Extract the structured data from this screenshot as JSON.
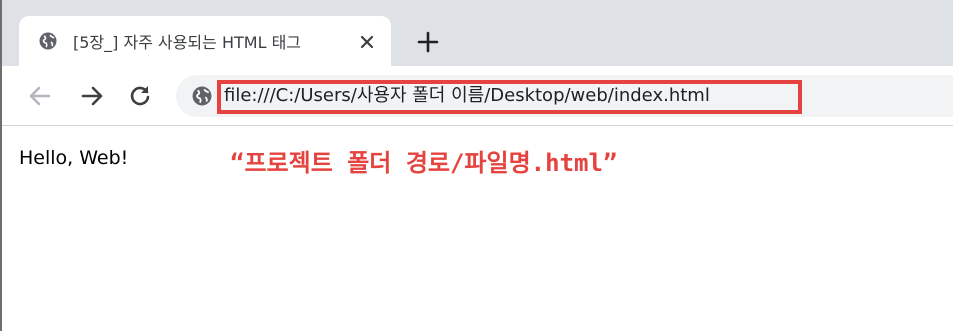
{
  "tab": {
    "title": "[5장_] 자주 사용되는 HTML 태그",
    "favicon": "globe-icon",
    "close": "close-icon"
  },
  "new_tab": "plus-icon",
  "toolbar": {
    "back": "arrow-left-icon",
    "forward": "arrow-right-icon",
    "reload": "reload-icon",
    "site_info": "globe-icon"
  },
  "address_bar": {
    "url": "file:///C:/Users/사용자 폴더 이름/Desktop/web/index.html"
  },
  "page": {
    "text": "Hello, Web!"
  },
  "annotation": {
    "text": "“프로젝트 폴더 경로/파일명.html”",
    "color": "#e5433f"
  },
  "colors": {
    "tabstrip": "#dee1e6",
    "omnibox": "#f1f3f4",
    "highlight": "#e5433f"
  }
}
